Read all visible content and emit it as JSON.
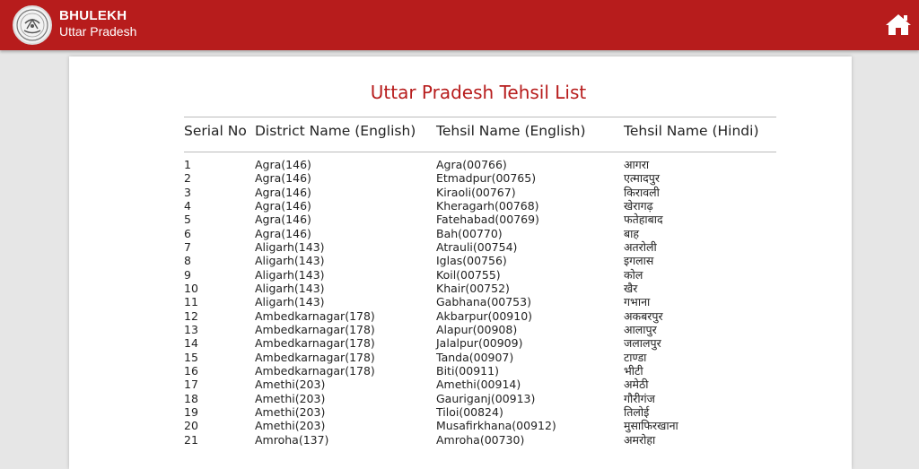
{
  "header": {
    "brand_line1": "BHULEKH",
    "brand_line2": "Uttar Pradesh",
    "logo_icon": "up-govt-emblem-icon",
    "home_icon": "home-icon",
    "bar_color": "#b71c1c"
  },
  "page": {
    "title": "Uttar Pradesh Tehsil List",
    "columns": [
      "Serial No",
      "District Name (English)",
      "Tehsil Name (English)",
      "Tehsil Name (Hindi)"
    ]
  },
  "rows": [
    [
      "1",
      "Agra(146)",
      "Agra(00766)",
      "आगरा"
    ],
    [
      "2",
      "Agra(146)",
      "Etmadpur(00765)",
      "एत्मादपुर"
    ],
    [
      "3",
      "Agra(146)",
      "Kiraoli(00767)",
      "किरावली"
    ],
    [
      "4",
      "Agra(146)",
      "Kheragarh(00768)",
      "खेरागढ़"
    ],
    [
      "5",
      "Agra(146)",
      "Fatehabad(00769)",
      "फतेहाबाद"
    ],
    [
      "6",
      "Agra(146)",
      "Bah(00770)",
      "बाह"
    ],
    [
      "7",
      "Aligarh(143)",
      "Atrauli(00754)",
      "अतरोली"
    ],
    [
      "8",
      "Aligarh(143)",
      "Iglas(00756)",
      "इगलास"
    ],
    [
      "9",
      "Aligarh(143)",
      "Koil(00755)",
      "कोल"
    ],
    [
      "10",
      "Aligarh(143)",
      "Khair(00752)",
      "खैर"
    ],
    [
      "11",
      "Aligarh(143)",
      "Gabhana(00753)",
      "गभाना"
    ],
    [
      "12",
      "Ambedkarnagar(178)",
      "Akbarpur(00910)",
      "अकबरपुर"
    ],
    [
      "13",
      "Ambedkarnagar(178)",
      "Alapur(00908)",
      "आलापुर"
    ],
    [
      "14",
      "Ambedkarnagar(178)",
      "Jalalpur(00909)",
      "जलालपुर"
    ],
    [
      "15",
      "Ambedkarnagar(178)",
      "Tanda(00907)",
      "टाण्डा"
    ],
    [
      "16",
      "Ambedkarnagar(178)",
      "Biti(00911)",
      "भीटी"
    ],
    [
      "17",
      "Amethi(203)",
      "Amethi(00914)",
      "अमेठी"
    ],
    [
      "18",
      "Amethi(203)",
      "Gauriganj(00913)",
      "गौरीगंज"
    ],
    [
      "19",
      "Amethi(203)",
      "Tiloi(00824)",
      "तिलोई"
    ],
    [
      "20",
      "Amethi(203)",
      "Musafirkhana(00912)",
      "मुसाफिरखाना"
    ],
    [
      "21",
      "Amroha(137)",
      "Amroha(00730)",
      "अमरोहा"
    ]
  ]
}
